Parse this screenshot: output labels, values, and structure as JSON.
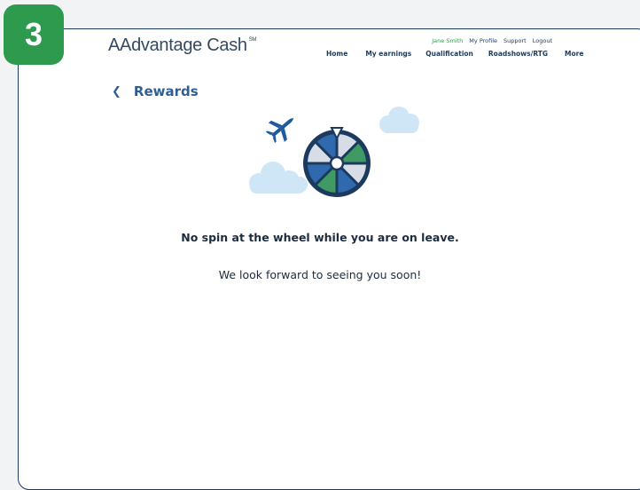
{
  "step_badge": "3",
  "brand": {
    "name": "AAdvantage Cash",
    "mark": "SM"
  },
  "user_links": [
    "Jane Smith",
    "My Profile",
    "Support",
    "Logout"
  ],
  "nav": [
    "Home",
    "My earnings",
    "Qualification",
    "Roadshows/RTG",
    "More"
  ],
  "page": {
    "title": "Rewards",
    "headline": "No spin at the wheel while you are on leave.",
    "message": "We look forward to seeing you soon!"
  },
  "colors": {
    "accent_green": "#2e9a4e",
    "navy": "#1c3a5e",
    "blue": "#2f5e94",
    "cloud": "#cfe6f7"
  },
  "icons": [
    "chevron-left-icon",
    "airplane-icon",
    "prize-wheel-icon",
    "cloud-icon"
  ]
}
